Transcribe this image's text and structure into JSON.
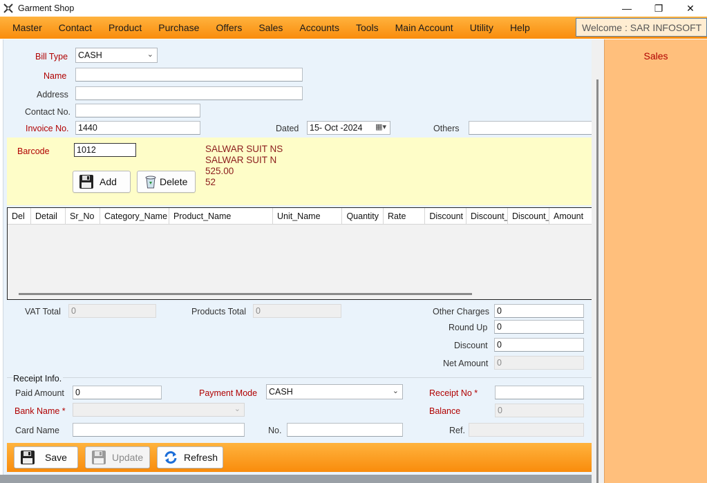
{
  "window": {
    "title": "Garment Shop",
    "minimize": "—",
    "maximize": "❐",
    "close": "✕"
  },
  "menu": {
    "items": [
      "Master",
      "Contact",
      "Product",
      "Purchase",
      "Offers",
      "Sales",
      "Accounts",
      "Tools",
      "Main Account",
      "Utility",
      "Help"
    ],
    "welcome": "Welcome : SAR INFOSOFT"
  },
  "form": {
    "bill_type_label": "Bill Type",
    "bill_type_value": "CASH",
    "name_label": "Name",
    "name_value": "",
    "address_label": "Address",
    "address_value": "",
    "contact_label": "Contact No.",
    "contact_value": "",
    "invoice_label": "Invoice No.",
    "invoice_value": "1440",
    "dated_label": "Dated",
    "dated_value": "15- Oct -2024",
    "others_label": "Others",
    "others_value": ""
  },
  "barcode": {
    "label": "Barcode",
    "value": "1012",
    "info": [
      "SALWAR SUIT NS",
      "SALWAR SUIT N",
      "525.00",
      "52"
    ],
    "add_label": "Add",
    "delete_label": "Delete"
  },
  "grid": {
    "columns": [
      "Del",
      "Detail",
      "Sr_No",
      "Category_Name",
      "Product_Name",
      "Unit_Name",
      "Quantity",
      "Rate",
      "Discount",
      "Discount_",
      "Discount_",
      "Amount"
    ],
    "rows": []
  },
  "totals": {
    "vat_label": "VAT Total",
    "vat_value": "0",
    "products_label": "Products Total",
    "products_value": "0",
    "other_charges_label": "Other Charges",
    "other_charges_value": "0",
    "round_up_label": "Round Up",
    "round_up_value": "0",
    "discount_label": "Discount",
    "discount_value": "0",
    "net_amount_label": "Net Amount",
    "net_amount_value": "0"
  },
  "receipt": {
    "legend": "Receipt Info.",
    "paid_amount_label": "Paid Amount",
    "paid_amount_value": "0",
    "payment_mode_label": "Payment Mode",
    "payment_mode_value": "CASH",
    "receipt_no_label": "Receipt No *",
    "receipt_no_value": "",
    "bank_name_label": "Bank Name *",
    "bank_name_value": "",
    "balance_label": "Balance",
    "balance_value": "0",
    "card_name_label": "Card Name",
    "card_name_value": "",
    "no_label": "No.",
    "no_value": "",
    "ref_label": "Ref.",
    "ref_value": ""
  },
  "footer": {
    "save_label": "Save",
    "update_label": "Update",
    "refresh_label": "Refresh"
  },
  "side_panel": {
    "title": "Sales"
  },
  "colors": {
    "menu_orange": "#f98c0c",
    "label_red": "#b00000",
    "panel_peach": "#ffbf7c",
    "barcode_yellow": "#fefdc8",
    "form_bg": "#eaf3fb"
  }
}
